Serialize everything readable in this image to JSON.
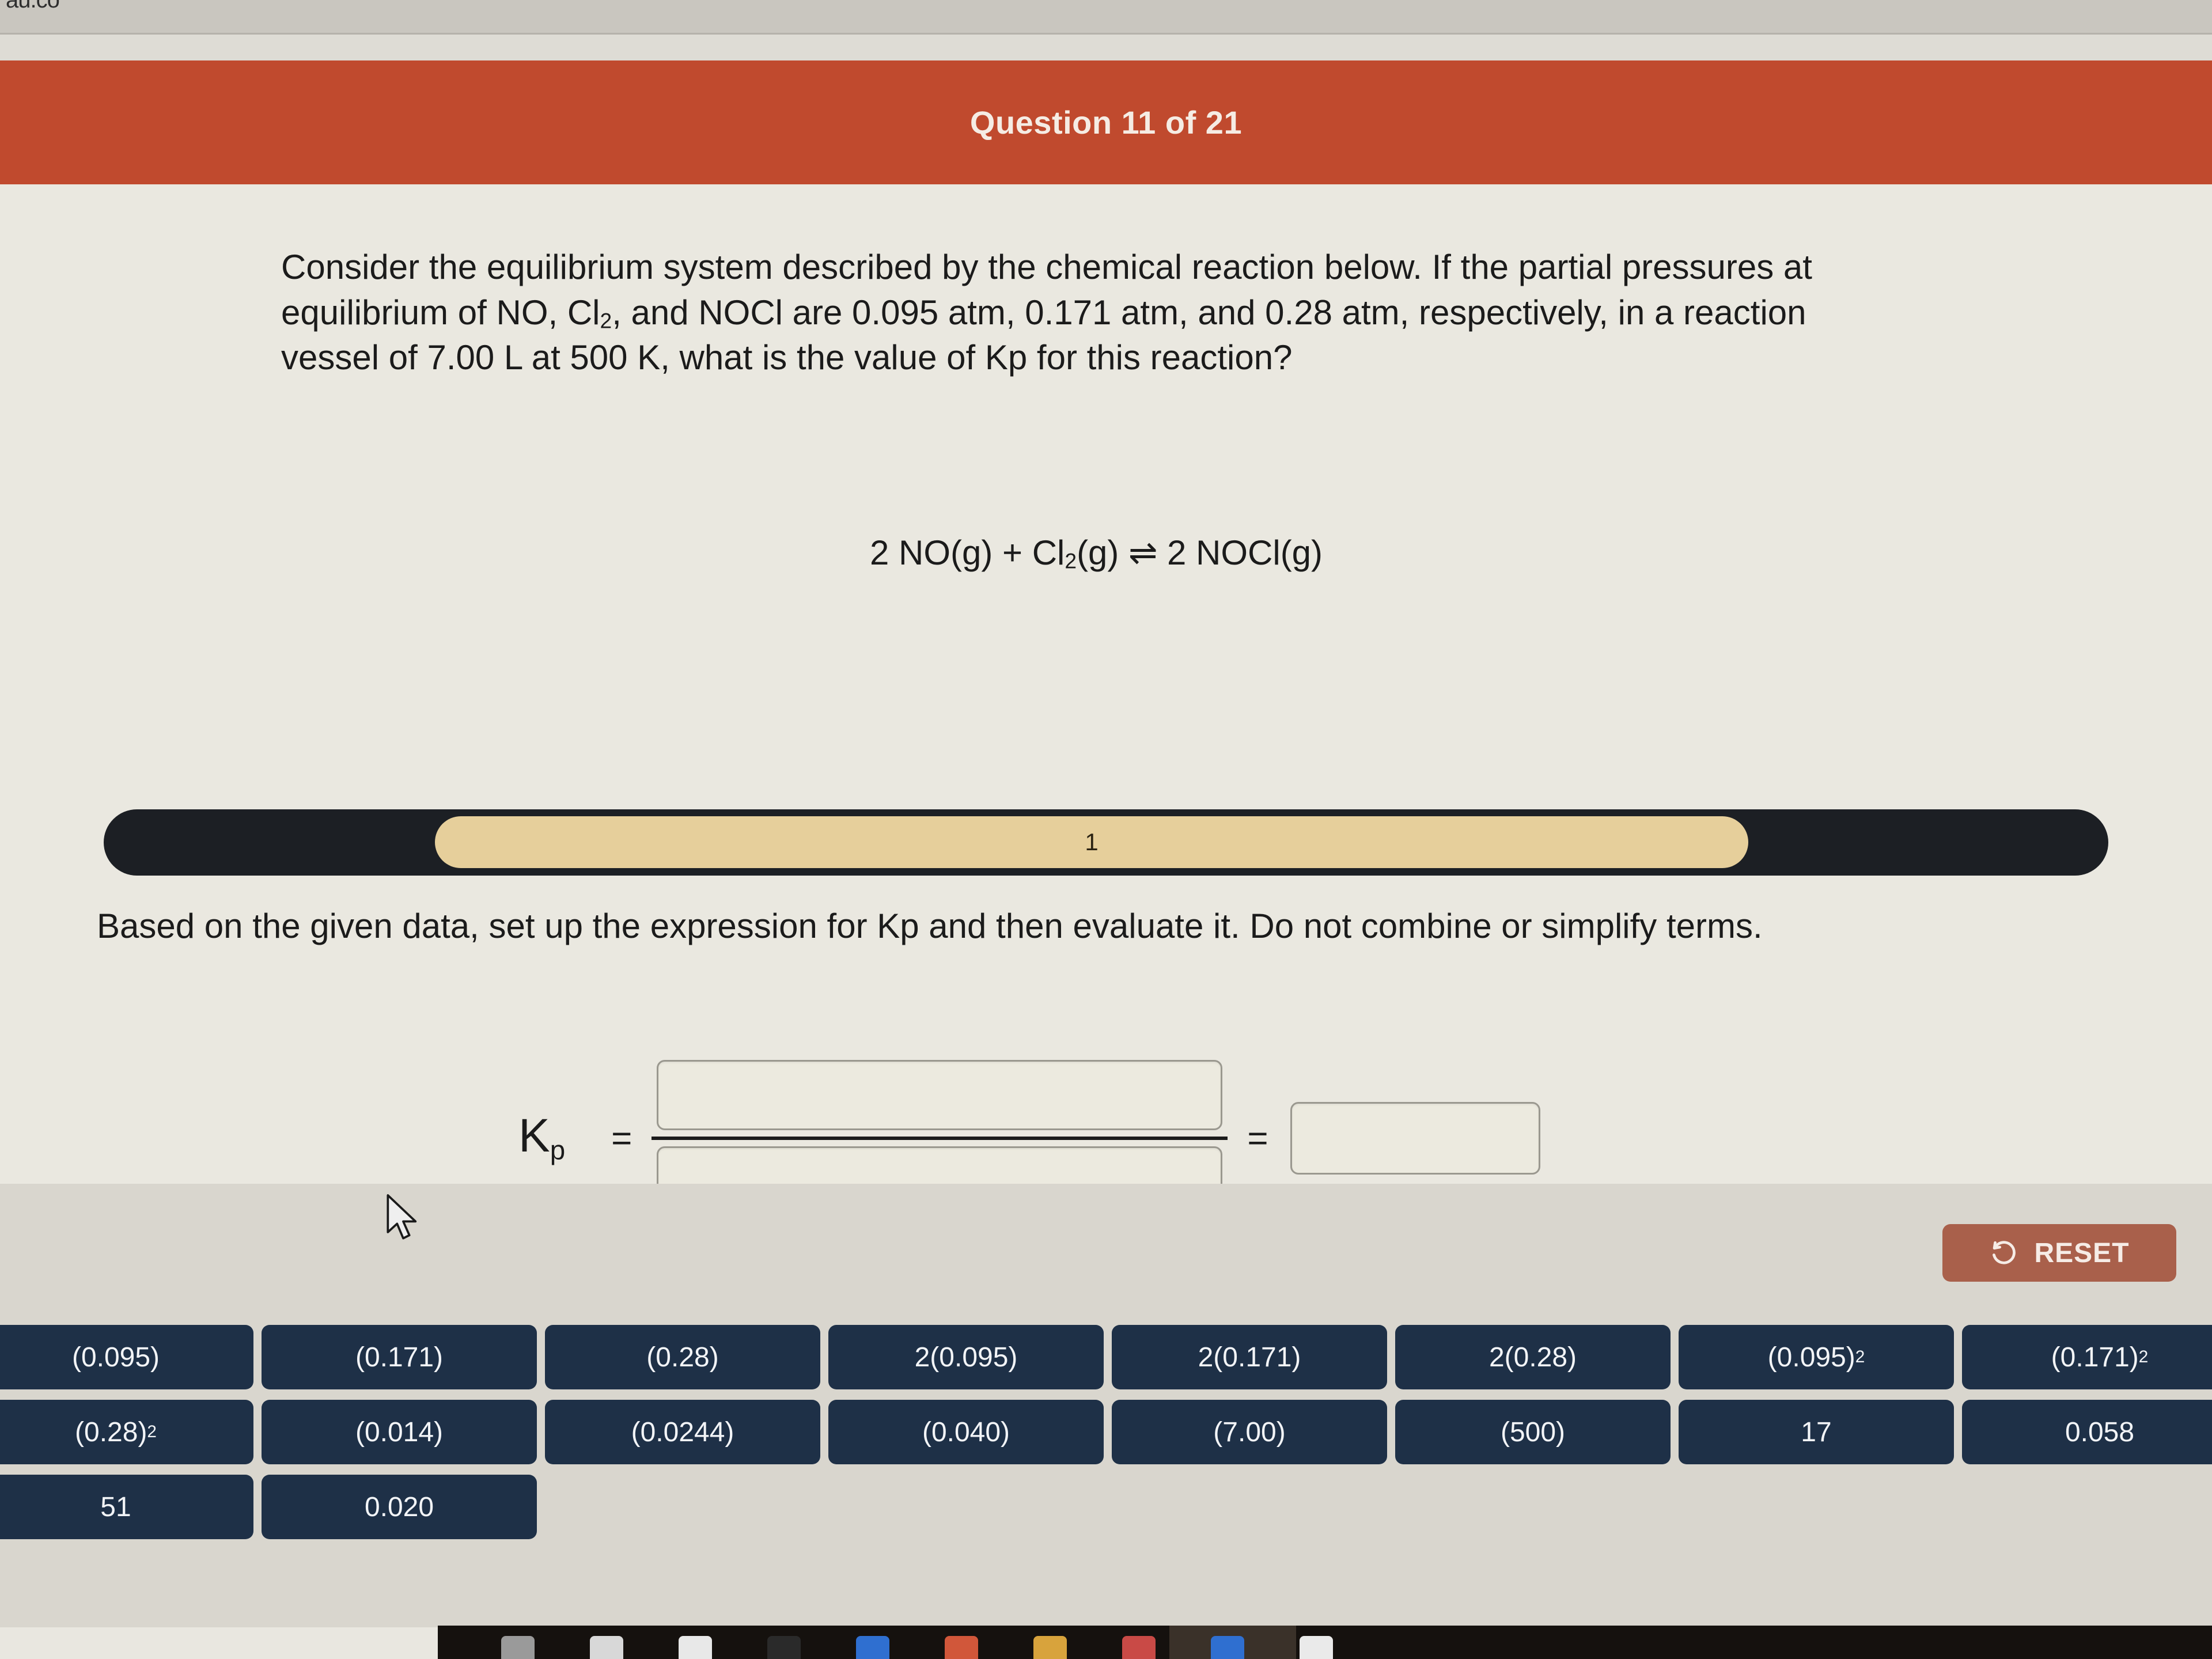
{
  "browser": {
    "url_fragment": "au.co"
  },
  "header": {
    "title": "Question 11 of 21"
  },
  "question": {
    "paragraph_part1": "Consider the equilibrium system described by the chemical reaction below. If the partial pressures at equilibrium of NO, Cl",
    "paragraph_sub1": "2",
    "paragraph_part2": ", and NOCl are 0.095 atm, 0.171 atm, and 0.28 atm, respectively, in a reaction vessel of 7.00 L at 500 K, what is the value of Kp for this reaction?",
    "equation_part1": "2 NO(g) + Cl",
    "equation_sub": "2",
    "equation_part2": "(g) ⇌ 2 NOCl(g)"
  },
  "dropbar": {
    "label": "1"
  },
  "instruction": {
    "text": "Based on the given data, set up the expression for Kp and then evaluate it. Do not combine or simplify terms."
  },
  "expression": {
    "kp_base": "K",
    "kp_sub": "p",
    "equals_1": "=",
    "equals_2": "=",
    "numerator_value": "",
    "denominator_value": "",
    "result_value": ""
  },
  "footer": {
    "reset_label": "RESET",
    "reset_icon": "refresh-counterclockwise-icon"
  },
  "tiles": [
    {
      "text": "(0.095)",
      "sup": ""
    },
    {
      "text": "(0.171)",
      "sup": ""
    },
    {
      "text": "(0.28)",
      "sup": ""
    },
    {
      "text": "2(0.095)",
      "sup": ""
    },
    {
      "text": "2(0.171)",
      "sup": ""
    },
    {
      "text": "2(0.28)",
      "sup": ""
    },
    {
      "text": "(0.095)",
      "sup": "2"
    },
    {
      "text": "(0.171)",
      "sup": "2"
    },
    {
      "text": "(0.28)",
      "sup": "2"
    },
    {
      "text": "(0.014)",
      "sup": ""
    },
    {
      "text": "(0.0244)",
      "sup": ""
    },
    {
      "text": "(0.040)",
      "sup": ""
    },
    {
      "text": "(7.00)",
      "sup": ""
    },
    {
      "text": "(500)",
      "sup": ""
    },
    {
      "text": "17",
      "sup": ""
    },
    {
      "text": "0.058",
      "sup": ""
    },
    {
      "text": "51",
      "sup": ""
    },
    {
      "text": "0.020",
      "sup": ""
    }
  ],
  "taskbar": {
    "icon_colors": [
      "#9a9a9a",
      "#d8d8d8",
      "#e8e8e8",
      "#2a2a2a",
      "#2f6fd0",
      "#d1573a",
      "#d8a33c",
      "#c94a46",
      "#2f6fd0",
      "#eaeaea"
    ]
  },
  "colors": {
    "header_red": "#c04a2e",
    "tile_navy": "#1e3047",
    "reset_brick": "#a9604b",
    "dropbar_dark": "#1c1f24",
    "dropbar_fill": "#e6cf9b",
    "page_cream": "#eae8e0",
    "footer_gray": "#d9d6ce"
  }
}
